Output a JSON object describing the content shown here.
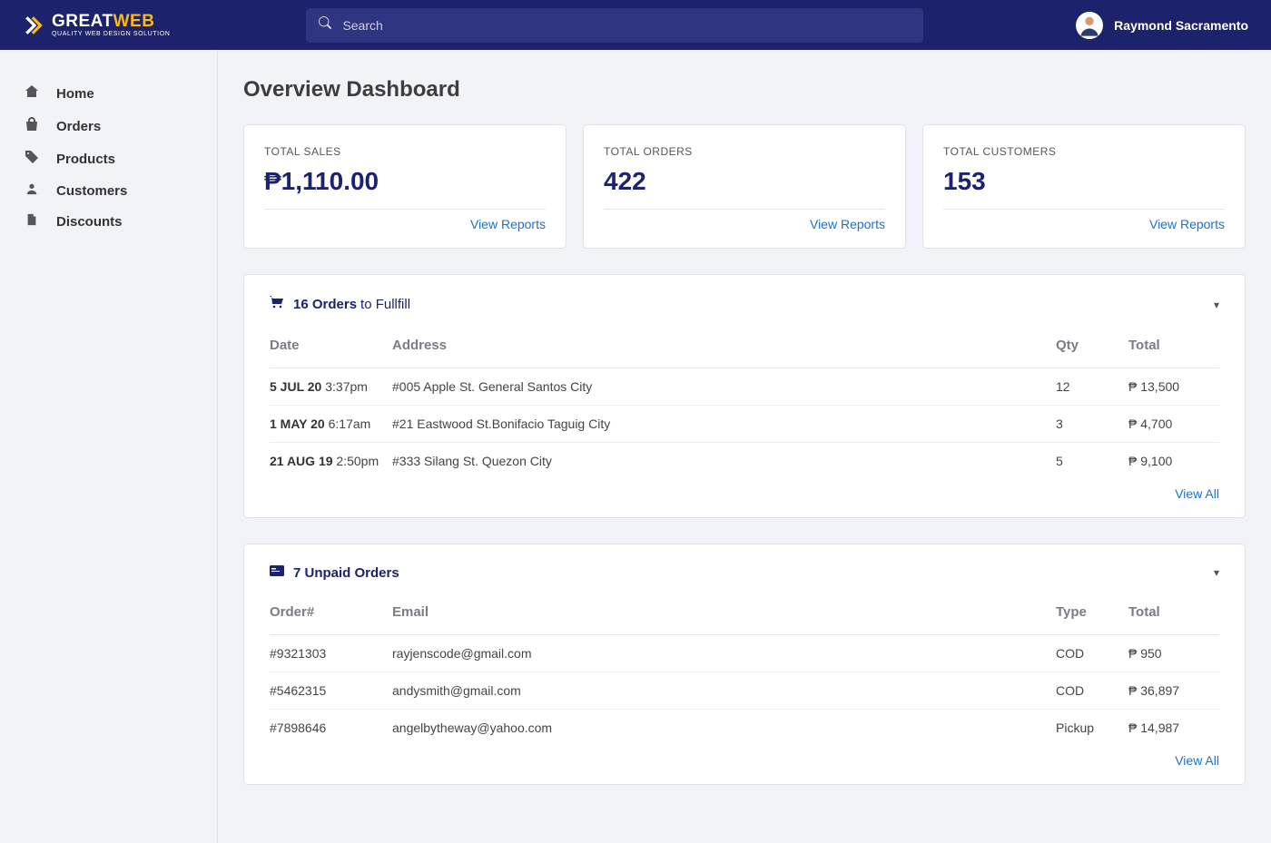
{
  "brand": {
    "name_white": "GREAT",
    "name_yellow": "WEB",
    "tagline": "QUALITY WEB DESIGN SOLUTION"
  },
  "search": {
    "placeholder": "Search"
  },
  "user": {
    "name": "Raymond Sacramento"
  },
  "sidebar": {
    "items": [
      {
        "label": "Home"
      },
      {
        "label": "Orders"
      },
      {
        "label": "Products"
      },
      {
        "label": "Customers"
      },
      {
        "label": "Discounts"
      }
    ]
  },
  "page": {
    "title": "Overview Dashboard"
  },
  "cards": [
    {
      "label": "TOTAL SALES",
      "value": "₱1,110.00",
      "link": "View Reports"
    },
    {
      "label": "TOTAL ORDERS",
      "value": "422",
      "link": "View Reports"
    },
    {
      "label": "TOTAL CUSTOMERS",
      "value": "153",
      "link": "View Reports"
    }
  ],
  "orders_panel": {
    "count": "16 Orders",
    "suffix": " to Fullfill",
    "columns": [
      "Date",
      "Address",
      "Qty",
      "Total"
    ],
    "rows": [
      {
        "date_bold": "5 JUL 20",
        "date_rest": " 3:37pm",
        "address": "#005 Apple St. General Santos City",
        "qty": "12",
        "total": "₱ 13,500"
      },
      {
        "date_bold": "1 MAY 20",
        "date_rest": " 6:17am",
        "address": "#21 Eastwood St.Bonifacio Taguig City",
        "qty": "3",
        "total": "₱ 4,700"
      },
      {
        "date_bold": "21 AUG 19",
        "date_rest": " 2:50pm",
        "address": "#333 Silang St. Quezon City",
        "qty": "5",
        "total": "₱ 9,100"
      }
    ],
    "link": "View All"
  },
  "unpaid_panel": {
    "title": "7 Unpaid Orders",
    "columns": [
      "Order#",
      "Email",
      "Type",
      "Total"
    ],
    "rows": [
      {
        "order": "#9321303",
        "email": "rayjenscode@gmail.com",
        "type": "COD",
        "total": "₱ 950"
      },
      {
        "order": "#5462315",
        "email": "andysmith@gmail.com",
        "type": "COD",
        "total": "₱ 36,897"
      },
      {
        "order": "#7898646",
        "email": "angelbytheway@yahoo.com",
        "type": "Pickup",
        "total": "₱ 14,987"
      }
    ],
    "link": "View All"
  }
}
